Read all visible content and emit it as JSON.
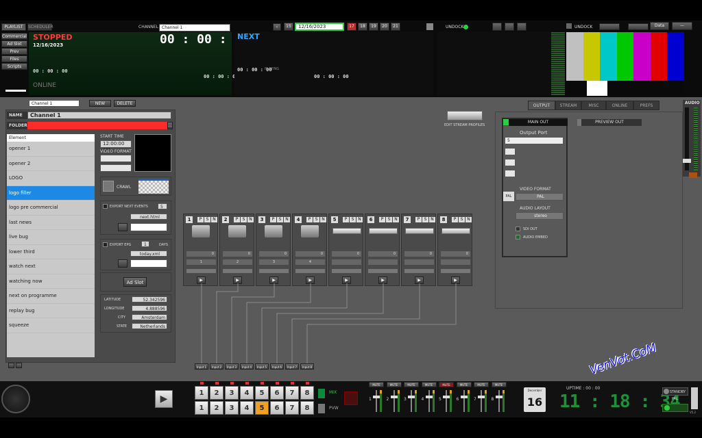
{
  "top": {
    "tabs": [
      "PLAYLIST",
      "SCHEDULER"
    ],
    "status": "STOPPED",
    "date": "12/16/2023",
    "channel_label": "CHANNEL",
    "channel_value": "Channel 1",
    "main_time": "00 : 00 : 00",
    "next_label": "NEXT",
    "online": "ONLINE",
    "playing_label": "PLAYING",
    "calendar_date": "12/16/2023",
    "day_buttons": [
      "15",
      "17",
      "18",
      "19",
      "20",
      "21"
    ],
    "undock": "UNDOCK",
    "data_btn": "Data",
    "left_menu": [
      "Commercial",
      "Ad Slot",
      "Prev",
      "Files",
      "Scripts"
    ],
    "small_time": "00 : 00 : 00"
  },
  "editor": {
    "channel_select": "Channel 1",
    "new_label": "NEW",
    "delete_label": "DELETE",
    "name_label": "NAME",
    "name_value": "Channel 1",
    "folder_label": "FOLDER",
    "list_header": "Element",
    "items": [
      "opener 1",
      "opener 2",
      "LOGO",
      "logo filler",
      "logo pre commercial",
      "last news",
      "live bug",
      "lower third",
      "watch next",
      "watching now",
      "next on programme",
      "replay bug",
      "squeeze"
    ],
    "selected_index": 3,
    "start_time_label": "START TIME",
    "start_time_value": "12:00:00 AM",
    "video_format_label": "VIDEO FORMAT",
    "crawl_label": "CRAWL",
    "export_next_label": "EXPORT NEXT EVENTS",
    "export_next_count": "5",
    "export_next_file": "next.html",
    "export_epg_label": "EXPORT EPG",
    "export_epg_count": "1",
    "days_label": "DAYS",
    "export_epg_file": "today.xml",
    "ad_slot_label": "Ad Slot",
    "latitude_label": "LATITUDE",
    "latitude_value": "52.342596",
    "longitude_label": "LONGITUDE",
    "longitude_value": "4.888596",
    "city_label": "CITY",
    "city_value": "Amsterdam",
    "state_label": "STATE",
    "state_value": "Netherlands"
  },
  "output": {
    "tabs": [
      "OUTPUT",
      "STREAM",
      "MISC",
      "ONLINE",
      "PREFS"
    ],
    "edit_stream_label": "EDIT STREAM PROFILES",
    "main_out": "MAIN OUT",
    "preview_out": "PREVIEW OUT",
    "output_port_label": "Output Port",
    "output_port_value": "5",
    "video_format_label": "VIDEO FORMAT",
    "video_format_value": "PAL",
    "audio_layout_label": "AUDIO LAYOUT",
    "audio_layout_value": "stereo",
    "sdi_out": "SDI OUT",
    "audio_embed": "AUDIO EMBED",
    "audio_label": "AUDIO",
    "pal_icon": "PAL"
  },
  "slots": [
    {
      "num": "1",
      "v1": "0",
      "v2": "1"
    },
    {
      "num": "2",
      "v1": "0",
      "v2": "2"
    },
    {
      "num": "3",
      "v1": "0",
      "v2": "3"
    },
    {
      "num": "4",
      "v1": "0",
      "v2": "4"
    },
    {
      "num": "5",
      "v1": "0",
      "v2": ""
    },
    {
      "num": "6",
      "v1": "0",
      "v2": ""
    },
    {
      "num": "7",
      "v1": "0",
      "v2": ""
    },
    {
      "num": "8",
      "v1": "0",
      "v2": ""
    }
  ],
  "slot_pin_labels": [
    "P",
    "S",
    "N"
  ],
  "bottom": {
    "input_labels": [
      "Input 1",
      "Input 2",
      "Input 3",
      "Input 4",
      "Input 5",
      "Input 6",
      "Input 7",
      "Input 8"
    ],
    "prog_keys": [
      "1",
      "2",
      "3",
      "4",
      "5",
      "6",
      "7",
      "8"
    ],
    "prev_keys": [
      "1",
      "2",
      "3",
      "4",
      "5",
      "6",
      "7",
      "8"
    ],
    "active_prev": 4,
    "mix_label": "MIX",
    "pvw_label": "PVW",
    "mute_labels": [
      "MUTE",
      "MUTE",
      "MUTE",
      "MUTE",
      "MUTE",
      "MUTE",
      "MUTE",
      "MUTE"
    ],
    "fader_nums": [
      "1",
      "2",
      "3",
      "4",
      "5",
      "6",
      "7",
      "8"
    ],
    "calendar_month": "December",
    "calendar_day": "16",
    "uptime_label": "UPTIME : 00 : 00",
    "clock": "11 : 18 : 34",
    "standby_label": "STANDBY",
    "pal_label": "PAL",
    "version": "V5.2"
  },
  "watermark": "VenVot.CoM",
  "colors": {
    "accent": "#1e88e5",
    "stopped": "#ff3b3b",
    "next": "#2aa8ff",
    "clock": "#1f8f3a",
    "folder": "#ff2a2a",
    "active_key": "#f0a020"
  }
}
